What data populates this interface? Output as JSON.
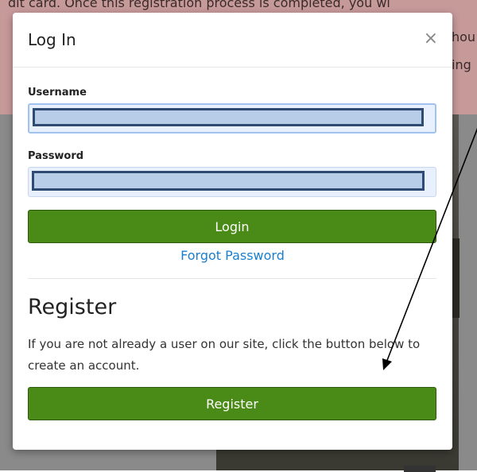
{
  "background": {
    "text_line_1": "dit card. Once this registration process is completed, you wi",
    "text_line_2": "hou",
    "text_line_3": "ing"
  },
  "modal": {
    "title": "Log In",
    "close_glyph": "×",
    "username": {
      "label": "Username",
      "value": ""
    },
    "password": {
      "label": "Password",
      "value": ""
    },
    "login_label": "Login",
    "forgot_label": "Forgot Password",
    "register": {
      "heading": "Register",
      "description": "If you are not already a user on our site, click the button below to create an account.",
      "button_label": "Register"
    }
  },
  "colors": {
    "accent_green": "#4a8a16",
    "link_blue": "#1a7fd0",
    "autofill_bg": "#e8f0fe"
  }
}
